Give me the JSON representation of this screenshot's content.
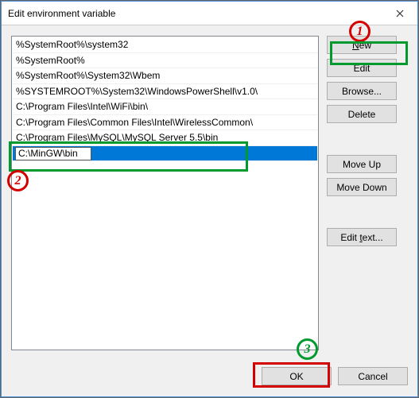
{
  "title": "Edit environment variable",
  "list": {
    "items": [
      "%SystemRoot%\\system32",
      "%SystemRoot%",
      "%SystemRoot%\\System32\\Wbem",
      "%SYSTEMROOT%\\System32\\WindowsPowerShell\\v1.0\\",
      "C:\\Program Files\\Intel\\WiFi\\bin\\",
      "C:\\Program Files\\Common Files\\Intel\\WirelessCommon\\",
      "C:\\Program Files\\MySQL\\MySQL Server 5.5\\bin"
    ],
    "editing_value": "C:\\MinGW\\bin"
  },
  "buttons": {
    "new": "New",
    "edit": "Edit",
    "browse": "Browse...",
    "delete": "Delete",
    "move_up": "Move Up",
    "move_down": "Move Down",
    "edit_text": "Edit text...",
    "ok": "OK",
    "cancel": "Cancel"
  },
  "annotations": {
    "n1": "1",
    "n2": "2",
    "n3": "3"
  }
}
